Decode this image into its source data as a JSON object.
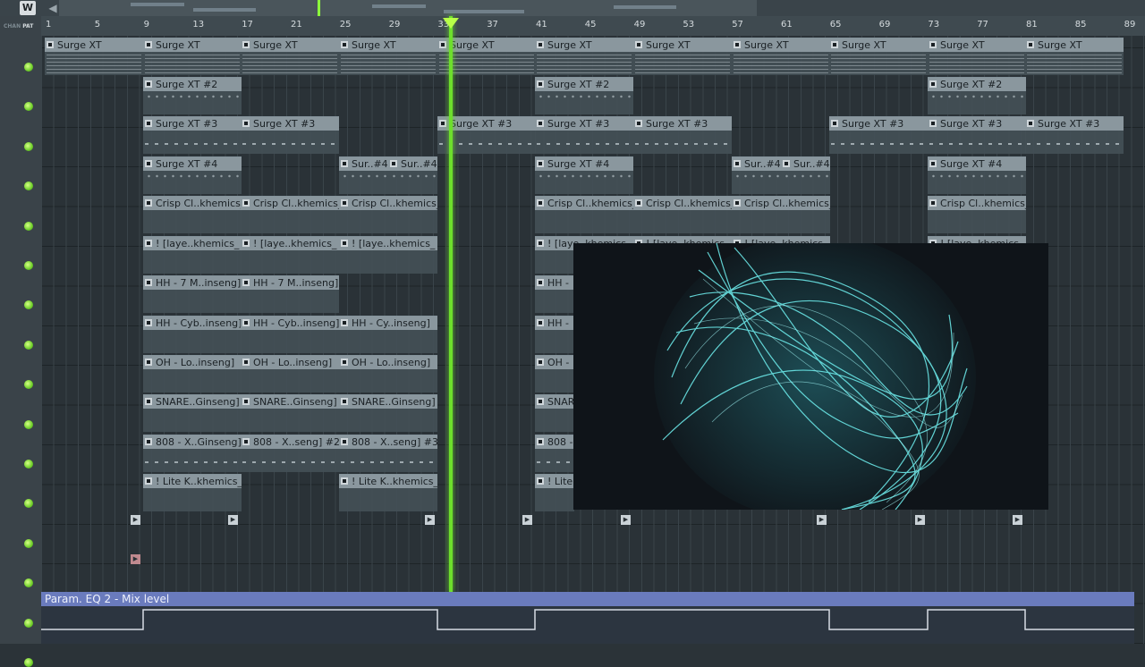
{
  "toolbar": {
    "snap_label": "W",
    "chan_label": "CHAN",
    "pat_label": "PAT",
    "scroll_left": "◀"
  },
  "ruler": {
    "ticks": [
      "1",
      "5",
      "9",
      "13",
      "17",
      "21",
      "25",
      "29",
      "33",
      "37",
      "41",
      "45",
      "49",
      "53",
      "57",
      "61",
      "65",
      "69",
      "73",
      "77",
      "81",
      "85",
      "89"
    ]
  },
  "clips": {
    "surge": "Surge XT",
    "surge2": "Surge XT #2",
    "surge3": "Surge XT #3",
    "surge4": "Surge XT #4",
    "sur4_short": "Sur..#4",
    "crisp": "Crisp Cl..khemics_",
    "laye": "! [laye..khemics_",
    "laye_short": "! [laye..khemics_",
    "hh7": "HH - 7 M..inseng]",
    "hh7_short": "HH -",
    "hhcyb": "HH - Cyb..inseng]",
    "hhcy": "HH - Cy..inseng]",
    "hh_short": "HH -",
    "oh": "OH - Lo..inseng]",
    "oh_short": "OH -",
    "snare": "SNARE..Ginseng]",
    "snare_short": "SNAR",
    "b808a": "808 - X..Ginseng]",
    "b808b": "808 - X..seng] #2",
    "b808c": "808 - X..seng] #3",
    "b808_short": "808 -",
    "lite": "! Lite K..khemics_",
    "lite_short": "! Lite"
  },
  "automation": {
    "label": "Param. EQ 2 - Mix level"
  },
  "colors": {
    "playhead": "#6ddf2c",
    "led": "#6fcf2a",
    "automation": "#6a7bbd"
  }
}
